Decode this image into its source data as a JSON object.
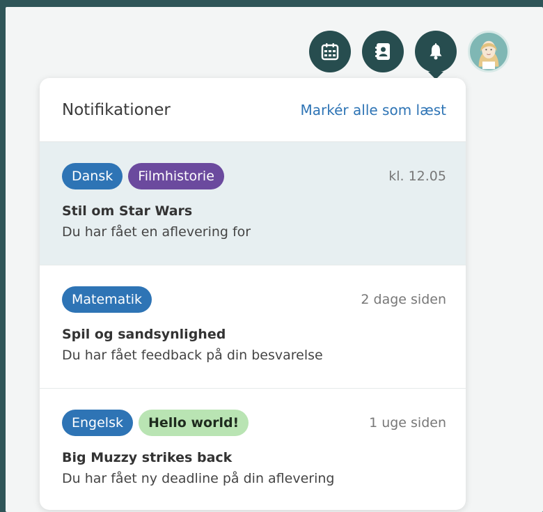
{
  "toolbar": {
    "icons": [
      "calendar-icon",
      "contacts-icon",
      "bell-icon"
    ],
    "accent": "#274d4f"
  },
  "panel": {
    "title": "Notifikationer",
    "mark_all": "Markér alle som læst"
  },
  "notifications": [
    {
      "unread": true,
      "tags": [
        {
          "label": "Dansk",
          "color": "#2e74b5"
        },
        {
          "label": "Filmhistorie",
          "color": "#6b4a9e"
        }
      ],
      "time": "kl. 12.05",
      "title": "Stil om Star Wars",
      "body": "Du har fået en aflevering for"
    },
    {
      "unread": false,
      "tags": [
        {
          "label": "Matematik",
          "color": "#2e74b5"
        }
      ],
      "time": "2 dage siden",
      "title": "Spil og sandsynlighed",
      "body": "Du har fået feedback på din besvarelse"
    },
    {
      "unread": false,
      "tags": [
        {
          "label": "Engelsk",
          "color": "#2e74b5"
        },
        {
          "label": "Hello world!",
          "color": "#b9e4b3"
        }
      ],
      "time": "1 uge siden",
      "title": "Big Muzzy strikes back",
      "body": "Du har fået ny deadline på din aflevering"
    }
  ]
}
